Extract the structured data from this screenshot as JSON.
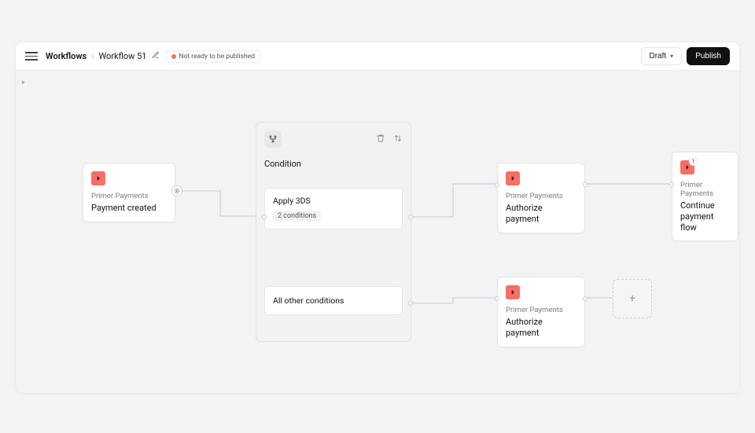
{
  "header": {
    "breadcrumb_root": "Workflows",
    "breadcrumb_current": "Workflow 51",
    "status_label": "Not ready to be published",
    "draft_label": "Draft",
    "publish_label": "Publish"
  },
  "nodes": {
    "start": {
      "subtitle": "Primer Payments",
      "title": "Payment created"
    },
    "condition": {
      "title": "Condition",
      "rows": [
        {
          "label": "Apply 3DS",
          "chip": "2 conditions"
        },
        {
          "label": "All other conditions"
        }
      ]
    },
    "authorize_top": {
      "subtitle": "Primer Payments",
      "title": "Authorize payment"
    },
    "authorize_bottom": {
      "subtitle": "Primer Payments",
      "title": "Authorize payment"
    },
    "continue_flow": {
      "subtitle": "Primer Payments",
      "title": "Continue payment flow",
      "badge": "1"
    }
  }
}
